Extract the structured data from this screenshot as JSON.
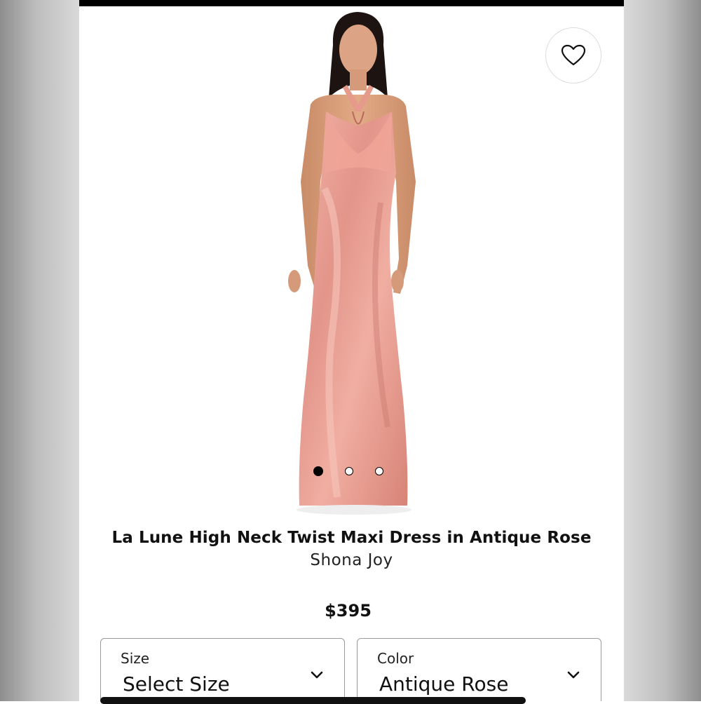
{
  "product": {
    "title": "La Lune High Neck Twist Maxi Dress in Antique Rose",
    "brand": "Shona Joy",
    "price": "$395"
  },
  "gallery": {
    "image_count": 3,
    "active_index": 0,
    "dress_color": "#e69a8e"
  },
  "favorite": {
    "icon": "heart-outline-icon"
  },
  "selectors": {
    "size": {
      "label": "Size",
      "value": "Select Size"
    },
    "color": {
      "label": "Color",
      "value": "Antique Rose"
    }
  }
}
